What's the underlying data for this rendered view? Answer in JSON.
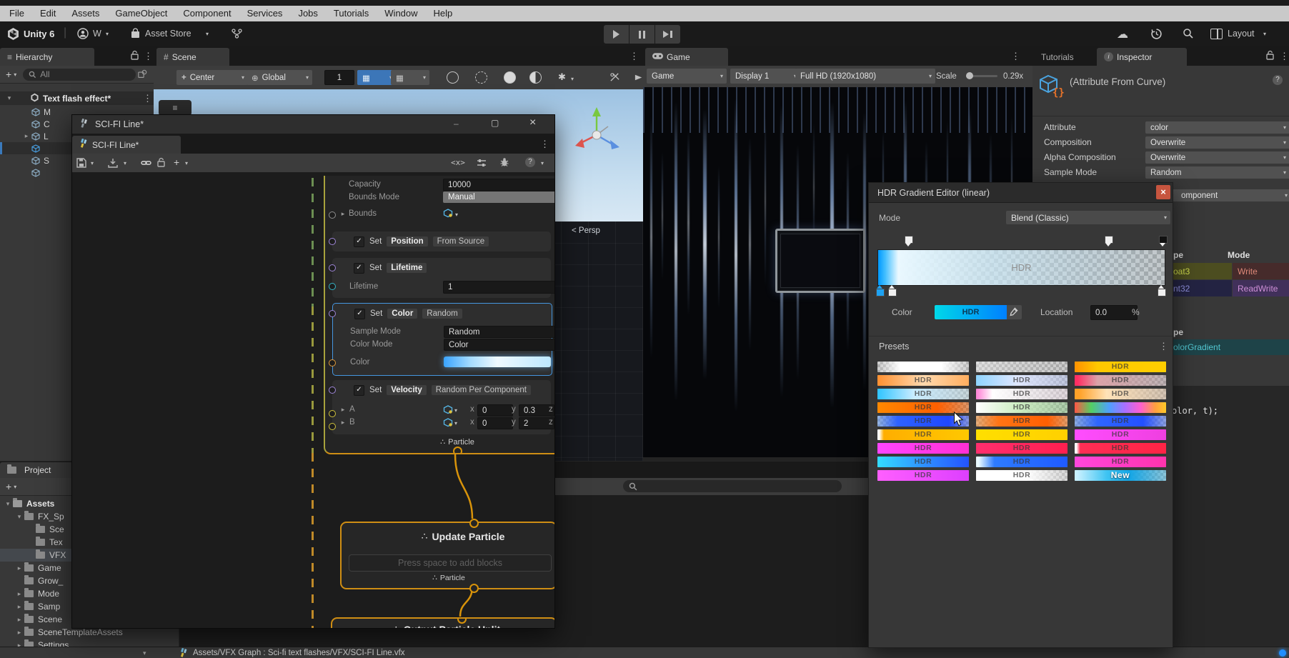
{
  "icons": {
    "kebab": "⋮",
    "arrow_down": "▾",
    "arrow_right": "▸",
    "close": "×",
    "check": "✓",
    "burger": "≡",
    "particle": "∴",
    "cloud": "☁",
    "globe": "⊕",
    "hash": "#",
    "plus": "+",
    "minus": "–",
    "maximize": "▢",
    "info": "i",
    "help": "?",
    "code": "<x>",
    "grid": "▦",
    "search_small": "⌕"
  },
  "window": {
    "menu": [
      "File",
      "Edit",
      "Assets",
      "GameObject",
      "Component",
      "Services",
      "Jobs",
      "Tutorials",
      "Window",
      "Help"
    ]
  },
  "toolbar": {
    "product": "Unity 6",
    "account": "W",
    "asset_store": "Asset Store",
    "layout": "Layout"
  },
  "hierarchy": {
    "tab": "Hierarchy",
    "search_placeholder": "All",
    "scene": "Text flash effect*",
    "items": [
      {
        "label": "M"
      },
      {
        "label": "C"
      },
      {
        "label": "L",
        "arrow": true
      },
      {
        "label": "",
        "selected": true
      },
      {
        "label": "S"
      },
      {
        "label": ""
      }
    ]
  },
  "scene_view": {
    "tab": "Scene",
    "pivot": "Center",
    "orientation": "Global",
    "snap": "1",
    "persp": "< Persp"
  },
  "game_view": {
    "tab": "Game",
    "mode": "Game",
    "display": "Display 1",
    "resolution": "Full HD (1920x1080)",
    "scale_label": "Scale",
    "scale": "0.29x",
    "streak_color": "#9fc6ff"
  },
  "vfx_window": {
    "title": "SCI-FI Line*",
    "tab": "SCI-FI Line*",
    "init": {
      "capacity_label": "Capacity",
      "capacity": "10000",
      "bounds_mode_label": "Bounds Mode",
      "bounds_mode": "Manual",
      "bounds_label": "Bounds",
      "set": "Set",
      "position": "Position",
      "from_source": "From Source",
      "lifetime": "Lifetime",
      "lifetime_label": "Lifetime",
      "lifetime_value": "1",
      "color": "Color",
      "random": "Random",
      "sample_mode_label": "Sample Mode",
      "sample_mode": "Random",
      "color_mode_label": "Color Mode",
      "color_mode": "Color",
      "color_label": "Color",
      "velocity": "Velocity",
      "random_per_component": "Random Per Component",
      "a_label": "A",
      "b_label": "B",
      "x_label": "x",
      "y_label": "y",
      "z_label": "z",
      "a_x": "0",
      "a_y": "0.3",
      "b_x": "0",
      "b_y": "2",
      "port": "Particle"
    },
    "update": {
      "title": "Update Particle",
      "placeholder": "Press space to add blocks",
      "port": "Particle"
    },
    "output": {
      "title": "Output Particle Unlit"
    }
  },
  "gradient_editor": {
    "title": "HDR Gradient Editor (linear)",
    "mode_label": "Mode",
    "mode": "Blend (Classic)",
    "bar_label": "HDR",
    "color_label": "Color",
    "swatch_label": "HDR",
    "location_label": "Location",
    "location": "0.0",
    "percent": "%",
    "presets_label": "Presets",
    "bar_gradient": "linear-gradient(90deg,#0099ff 0%,#44bfff 2.5%,#eaf8ff 7%,rgba(226,246,255,0.93) 16%,rgba(206,236,250,0.75) 40%,rgba(196,231,248,0.45) 70%,rgba(190,228,246,0.15) 100%)",
    "swatch_gradient": "linear-gradient(90deg,#00d8e8,#0080ff)",
    "presets": [
      {
        "label": "",
        "bg": "linear-gradient(90deg,rgba(255,255,255,0.15),#ffffff 25%,#ffffff 70%,rgba(255,255,255,0.2))",
        "checker": true
      },
      {
        "label": "",
        "bg": "linear-gradient(90deg,rgba(255,255,255,0.45),rgba(255,255,255,0.12))",
        "checker": true
      },
      {
        "label": "HDR",
        "bg": "linear-gradient(90deg,#ff9500 2%,#ffc800 25%,#ffcf00)",
        "checker": true
      },
      {
        "label": "HDR",
        "bg": "linear-gradient(90deg,#ff9030,#ffd9ae 50%,#ffad5e)",
        "checker": false
      },
      {
        "label": "HDR",
        "bg": "linear-gradient(90deg,#8fd4ff,#dfe7ff 45%,rgba(190,205,255,0.45))",
        "checker": true
      },
      {
        "label": "HDR",
        "bg": "linear-gradient(90deg,#ff2e63 3%,#dba3a8 25%,rgba(185,160,165,0.4))",
        "checker": true
      },
      {
        "label": "HDR",
        "bg": "linear-gradient(90deg,#2fc4ff,#c9ecff 40%,rgba(205,236,246,0.45))",
        "checker": true
      },
      {
        "label": "HDR",
        "bg": "linear-gradient(90deg,#ff8ad8 2%,#ffffff 18%,rgba(255,235,248,0.45))",
        "checker": true
      },
      {
        "label": "HDR",
        "bg": "linear-gradient(90deg,#ffa128 5%,#ffe2b8 35%,rgba(226,196,166,0.5))",
        "checker": true
      },
      {
        "label": "HDR",
        "bg": "linear-gradient(90deg,#ff8800,#ff5f00 65%,rgba(255,100,0,0.45))",
        "checker": true
      },
      {
        "label": "HDR",
        "bg": "linear-gradient(90deg,#ffffff,#cdeec2 45%,rgba(140,215,135,0.4))",
        "checker": true
      },
      {
        "label": "",
        "bg": "linear-gradient(90deg,#ff5545,#53cf63 18%,#4f9fff 38%,#a96fff 55%,#ff5fd0 72%,#ff9f3f 88%,#ffc928)",
        "checker": false
      },
      {
        "label": "HDR",
        "bg": "linear-gradient(90deg,rgba(110,170,255,0.5),#2e62ff 22%,#1f47ff 78%,rgba(80,110,255,0.5))",
        "checker": true
      },
      {
        "label": "HDR",
        "bg": "linear-gradient(90deg,rgba(255,160,70,0.55),#ff7414 25%,#ff5f02 78%,rgba(255,130,40,0.55))",
        "checker": true
      },
      {
        "label": "HDR",
        "bg": "linear-gradient(90deg,rgba(90,150,255,0.5),#2e66ff 25%,#2450ff 75%,rgba(95,135,255,0.5))",
        "checker": true
      },
      {
        "label": "HDR",
        "bg": "linear-gradient(90deg,#ffffff 0 2%,#ffae00 7%,#ffc800)",
        "checker": false
      },
      {
        "label": "HDR",
        "bg": "linear-gradient(90deg,#ffdf00,#ffd000)",
        "checker": false
      },
      {
        "label": "HDR",
        "bg": "linear-gradient(90deg,#ff4dff,#ef3fe0)",
        "checker": false
      },
      {
        "label": "HDR",
        "bg": "linear-gradient(90deg,#ff45ff,#ff2fd4)",
        "checker": false
      },
      {
        "label": "HDR",
        "bg": "linear-gradient(90deg,#ff2e6e,#ff1f4f)",
        "checker": false
      },
      {
        "label": "HDR",
        "bg": "linear-gradient(90deg,#ffffff 0 2%,#ff2e55 6%,#ff2445)",
        "checker": false
      },
      {
        "label": "HDR",
        "bg": "linear-gradient(90deg,#33dcff,#2e8bff 55%,#2453ff)",
        "checker": false
      },
      {
        "label": "HDR",
        "bg": "linear-gradient(90deg,#eafaff 0 3%,#2e7bff 20%,#1f5aff)",
        "checker": false
      },
      {
        "label": "HDR",
        "bg": "linear-gradient(90deg,#ff47dc,#ff33ad)",
        "checker": false
      },
      {
        "label": "HDR",
        "bg": "linear-gradient(90deg,#ff5fff,#dd3fff)",
        "checker": false
      },
      {
        "label": "HDR",
        "bg": "linear-gradient(90deg,#ffffff,#ffffff 55%,rgba(255,255,255,0.35))",
        "checker": true
      },
      {
        "label": "New",
        "bg": "linear-gradient(90deg,#c8f0ff 3%,#3fc4f2 35%,#14a6e6 60%,rgba(90,200,240,0.5))",
        "checker": true,
        "new": true
      }
    ]
  },
  "inspector": {
    "tab_tutorials": "Tutorials",
    "tab_inspector": "Inspector",
    "title": "(Attribute From Curve)",
    "fields": [
      {
        "label": "Attribute",
        "value": "color"
      },
      {
        "label": "Composition",
        "value": "Overwrite"
      },
      {
        "label": "Alpha Composition",
        "value": "Overwrite"
      },
      {
        "label": "Sample Mode",
        "value": "Random"
      }
    ],
    "clipped_field": "omponent",
    "type_header": "pe",
    "mode_header": "Mode",
    "type_rows": [
      {
        "type": "oat3",
        "type_fg": "#cdd94c",
        "type_bg": "#4c4d20",
        "mode": "Write",
        "mode_fg": "#dd8878",
        "mode_bg": "#462b2b"
      },
      {
        "type": "nt32",
        "type_fg": "#9090dd",
        "type_bg": "#232342",
        "mode": "ReadWrite",
        "mode_fg": "#cf8fd8",
        "mode_bg": "#41305a"
      }
    ],
    "type_header2": "pe",
    "gradient_type": {
      "label": "olorGradient",
      "fg": "#52c8d2",
      "bg": "#1e4348"
    },
    "code": "olor, t);"
  },
  "project": {
    "tab": "Project",
    "items": [
      {
        "label": "Assets",
        "depth": 0,
        "arrow": "open",
        "bold": true
      },
      {
        "label": "FX_Sp",
        "depth": 1,
        "arrow": "open"
      },
      {
        "label": "Sce",
        "depth": 2
      },
      {
        "label": "Tex",
        "depth": 2
      },
      {
        "label": "VFX",
        "depth": 2,
        "selected": true
      },
      {
        "label": "Game",
        "depth": 1,
        "arrow": "closed"
      },
      {
        "label": "Grow_",
        "depth": 1
      },
      {
        "label": "Mode",
        "depth": 1,
        "arrow": "closed"
      },
      {
        "label": "Samp",
        "depth": 1,
        "arrow": "closed"
      },
      {
        "label": "Scene",
        "depth": 1,
        "arrow": "closed"
      },
      {
        "label": "SceneTemplateAssets",
        "depth": 1,
        "arrow": "closed"
      },
      {
        "label": "Settings",
        "depth": 1,
        "arrow": "closed"
      }
    ]
  },
  "status": {
    "path": "Assets/VFX Graph : Sci-fi text flashes/VFX/SCI-FI Line.vfx"
  },
  "colors": {
    "selection_blue": "#4596e0",
    "node_orange": "#cf8e14",
    "wire_green": "#6c8f52",
    "wire_olive": "#99993d",
    "hdr_blue": "#1ba0f0",
    "close_red": "#c7553f"
  }
}
